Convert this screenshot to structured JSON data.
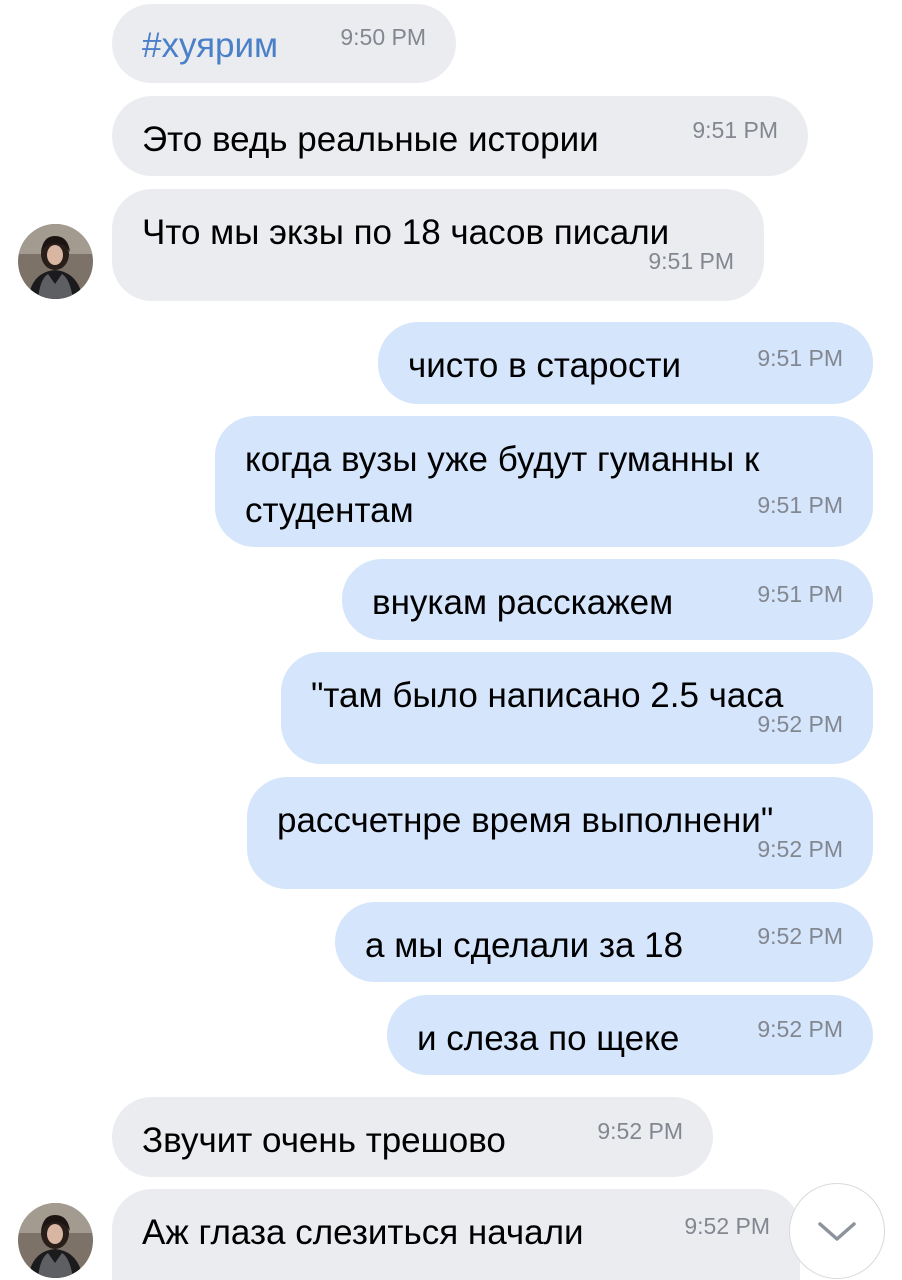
{
  "messages": [
    {
      "text": "#хуярим",
      "time": "9:50 PM",
      "direction": "in"
    },
    {
      "text": "Это ведь реальные истории",
      "time": "9:51 PM",
      "direction": "in"
    },
    {
      "text": "Что мы экзы по 18 часов писали",
      "time": "9:51 PM",
      "direction": "in"
    },
    {
      "text": "чисто в старости",
      "time": "9:51 PM",
      "direction": "out"
    },
    {
      "text_line1": "когда вузы уже будут гуманны к",
      "text_line2": "студентам",
      "time": "9:51 PM",
      "direction": "out"
    },
    {
      "text": "внукам расскажем",
      "time": "9:51 PM",
      "direction": "out"
    },
    {
      "text": "\"там было написано 2.5 часа",
      "time": "9:52 PM",
      "direction": "out"
    },
    {
      "text": "рассчетнре время выполнени\"",
      "time": "9:52 PM",
      "direction": "out"
    },
    {
      "text": "а мы сделали за 18",
      "time": "9:52 PM",
      "direction": "out"
    },
    {
      "text": "и слеза по щеке",
      "time": "9:52 PM",
      "direction": "out"
    },
    {
      "text": "Звучит очень трешово",
      "time": "9:52 PM",
      "direction": "in"
    },
    {
      "text": "Аж глаза слезиться начали",
      "time": "9:52 PM",
      "direction": "in"
    }
  ],
  "scroll_button": {
    "icon": "chevron-down-icon"
  },
  "colors": {
    "incoming_bubble": "#ebecf0",
    "outgoing_bubble": "#d4e5fc",
    "hashtag": "#4a80c8",
    "timestamp": "#838790"
  }
}
